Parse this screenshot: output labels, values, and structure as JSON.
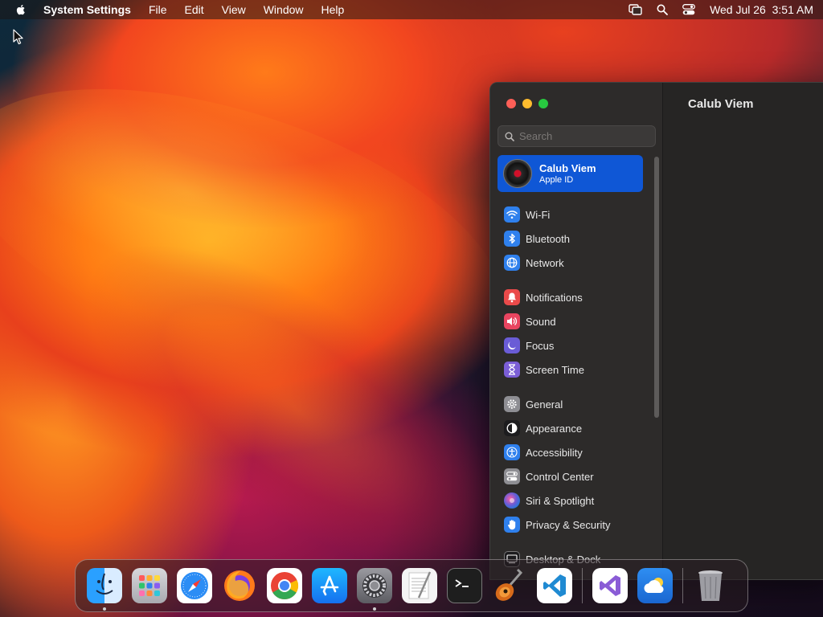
{
  "menubar": {
    "app_name": "System Settings",
    "items": [
      "File",
      "Edit",
      "View",
      "Window",
      "Help"
    ],
    "clock": "Wed Jul 26  3:51 AM"
  },
  "window": {
    "title": "Calub Viem",
    "search_placeholder": "Search",
    "account": {
      "name": "Calub Viem",
      "subtitle": "Apple ID"
    },
    "groups": [
      [
        {
          "label": "Wi-Fi",
          "icon": "wifi-icon",
          "color": "#2f80ed"
        },
        {
          "label": "Bluetooth",
          "icon": "bluetooth-icon",
          "color": "#2f80ed"
        },
        {
          "label": "Network",
          "icon": "globe-icon",
          "color": "#2f80ed"
        }
      ],
      [
        {
          "label": "Notifications",
          "icon": "bell-icon",
          "color": "#ea4a4a"
        },
        {
          "label": "Sound",
          "icon": "speaker-icon",
          "color": "#e94560"
        },
        {
          "label": "Focus",
          "icon": "moon-icon",
          "color": "#6a5cd6"
        },
        {
          "label": "Screen Time",
          "icon": "hourglass-icon",
          "color": "#7b5ed6"
        }
      ],
      [
        {
          "label": "General",
          "icon": "gear-icon",
          "color": "#8e8e93"
        },
        {
          "label": "Appearance",
          "icon": "appearance-icon",
          "color": "#1c1c1e"
        },
        {
          "label": "Accessibility",
          "icon": "accessibility-icon",
          "color": "#2f80ed"
        },
        {
          "label": "Control Center",
          "icon": "control-center-icon",
          "color": "#8e8e93"
        },
        {
          "label": "Siri & Spotlight",
          "icon": "siri-icon",
          "color": "#5b4bd6"
        },
        {
          "label": "Privacy & Security",
          "icon": "hand-icon",
          "color": "#2f80ed"
        }
      ],
      [
        {
          "label": "Desktop & Dock",
          "icon": "desktop-icon",
          "color": "#1c1c1e"
        }
      ]
    ]
  },
  "dock": {
    "apps": [
      {
        "name": "Finder",
        "icon": "finder-icon",
        "running": true
      },
      {
        "name": "Launchpad",
        "icon": "launchpad-icon",
        "running": false
      },
      {
        "name": "Safari",
        "icon": "safari-icon",
        "running": false
      },
      {
        "name": "Firefox",
        "icon": "firefox-icon",
        "running": false
      },
      {
        "name": "Chrome",
        "icon": "chrome-icon",
        "running": false
      },
      {
        "name": "App Store",
        "icon": "app-store-icon",
        "running": false
      },
      {
        "name": "System Settings",
        "icon": "system-settings-icon",
        "running": true
      },
      {
        "name": "TextEdit",
        "icon": "textedit-icon",
        "running": false
      },
      {
        "name": "Terminal",
        "icon": "terminal-icon",
        "running": false
      },
      {
        "name": "GarageBand",
        "icon": "guitar-icon",
        "running": false
      },
      {
        "name": "Visual Studio Code",
        "icon": "vscode-icon",
        "running": false
      }
    ],
    "apps_right": [
      {
        "name": "Visual Studio",
        "icon": "visual-studio-icon",
        "running": false
      },
      {
        "name": "Weather",
        "icon": "weather-icon",
        "running": false
      }
    ],
    "trash": {
      "name": "Trash",
      "icon": "trash-icon"
    }
  }
}
